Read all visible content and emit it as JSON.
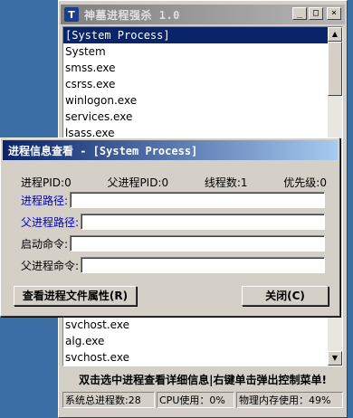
{
  "window": {
    "title": "神墓进程强杀 1.0",
    "icon": "app-icon",
    "icon_glyph": "T",
    "minimize_label": "_",
    "maximize_label": "□",
    "close_label": "×"
  },
  "processes": {
    "top": [
      "[System Process]",
      "System",
      "smss.exe",
      "csrss.exe",
      "winlogon.exe",
      "services.exe",
      "lsass.exe"
    ],
    "bottom": [
      "svchost.exe",
      "alg.exe",
      "svchost.exe"
    ],
    "selected_index": 0
  },
  "hint": "双击选中进程查看详细信息|右键单击弹出控制菜单!",
  "status": {
    "total": "系统总进程数:28",
    "cpu": "CPU使用：0%",
    "mem": "物理内存使用：49%"
  },
  "dialog": {
    "title": "进程信息查看 - [System Process]",
    "pid_label": "进程PID:",
    "pid_value": "0",
    "ppid_label": "父进程PID:",
    "ppid_value": "0",
    "threads_label": "线程数:",
    "threads_value": "1",
    "priority_label": "优先级:",
    "priority_value": "0",
    "path_label": "进程路径:",
    "path_value": "",
    "parent_path_label": "父进程路径:",
    "parent_path_value": "",
    "cmdline_label": "启动命令:",
    "cmdline_value": "",
    "parent_cmdline_label": "父进程命令:",
    "parent_cmdline_value": "",
    "view_props_button": "查看进程文件属性(R)",
    "close_button": "关闭(C)"
  }
}
